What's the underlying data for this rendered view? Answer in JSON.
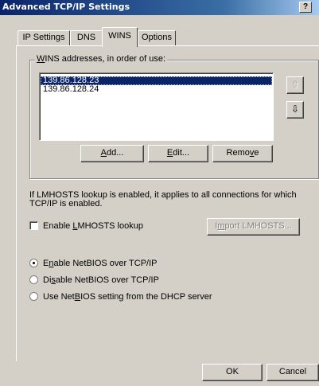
{
  "window": {
    "title": "Advanced TCP/IP Settings",
    "help_label": "?"
  },
  "tabs": [
    {
      "label": "IP Settings"
    },
    {
      "label": "DNS"
    },
    {
      "label": "WINS"
    },
    {
      "label": "Options"
    }
  ],
  "wins": {
    "group_label_prefix": "",
    "group_label_access": "W",
    "group_label_rest": "INS addresses, in order of use:",
    "addresses": [
      "139.86.128.23",
      "139.86.128.24"
    ],
    "selected_index": 0,
    "add_access": "A",
    "add_rest": "dd...",
    "edit_access": "E",
    "edit_rest": "dit...",
    "remove_pre": "Remo",
    "remove_access": "v",
    "remove_rest": "e",
    "up_icon": "⇧",
    "down_icon": "⇩"
  },
  "lmhosts": {
    "info": "If LMHOSTS lookup is enabled, it applies to all connections for which TCP/IP is enabled.",
    "enable_pre": "Enable ",
    "enable_access": "L",
    "enable_rest": "MHOSTS lookup",
    "enabled": false,
    "import_pre": "I",
    "import_access": "m",
    "import_rest": "port LMHOSTS..."
  },
  "netbios": {
    "options": [
      {
        "pre": "E",
        "access": "n",
        "rest": "able NetBIOS over TCP/IP",
        "checked": true
      },
      {
        "pre": "Di",
        "access": "s",
        "rest": "able NetBIOS over TCP/IP",
        "checked": false
      },
      {
        "pre": "Use Net",
        "access": "B",
        "rest": "IOS setting from the DHCP server",
        "checked": false
      }
    ]
  },
  "footer": {
    "ok_label": "OK",
    "cancel_label": "Cancel"
  }
}
